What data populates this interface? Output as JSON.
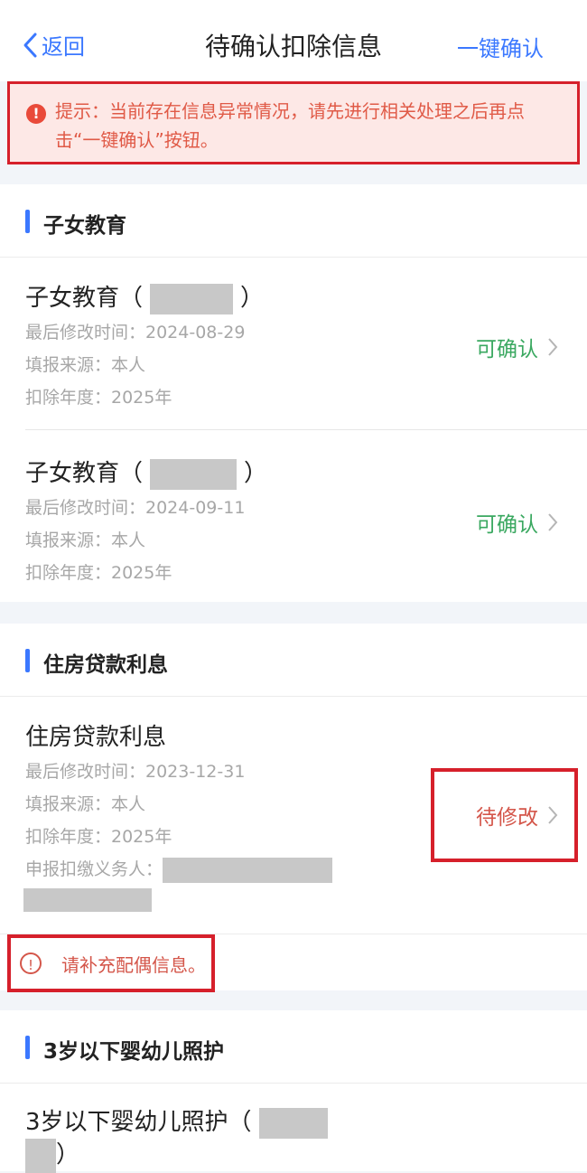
{
  "nav": {
    "back_label": "返回",
    "title": "待确认扣除信息",
    "confirm_all_label": "一键确认"
  },
  "tip": {
    "icon": "exclamation-icon",
    "text": "提示：当前存在信息异常情况，请先进行相关处理之后再点击“一键确认”按钮。"
  },
  "sections": [
    {
      "title": "子女教育",
      "items": [
        {
          "name": "子女教育（",
          "name_end": "）",
          "modified": "最后修改时间：2024-08-29",
          "source": "填报来源：本人",
          "year": "扣除年度：2025年",
          "status": "可确认"
        },
        {
          "name": "子女教育（",
          "name_end": "）",
          "modified": "最后修改时间：2024-09-11",
          "source": "填报来源：本人",
          "year": "扣除年度：2025年",
          "status": "可确认"
        }
      ]
    },
    {
      "title": "住房贷款利息",
      "items": [
        {
          "name": "住房贷款利息",
          "modified": "最后修改时间：2023-12-31",
          "source": "填报来源：本人",
          "year": "扣除年度：2025年",
          "agent": "申报扣缴义务人：",
          "status": "待修改"
        }
      ],
      "warning": "请补充配偶信息。"
    },
    {
      "title": "3岁以下婴幼儿照护",
      "items": [
        {
          "name": "3岁以下婴幼儿照护（",
          "name_end": "）"
        }
      ]
    }
  ],
  "colors": {
    "accent": "#3b78ff",
    "confirmable": "#3aa860",
    "pending": "#d4564a",
    "alert_border": "#d6202b"
  }
}
